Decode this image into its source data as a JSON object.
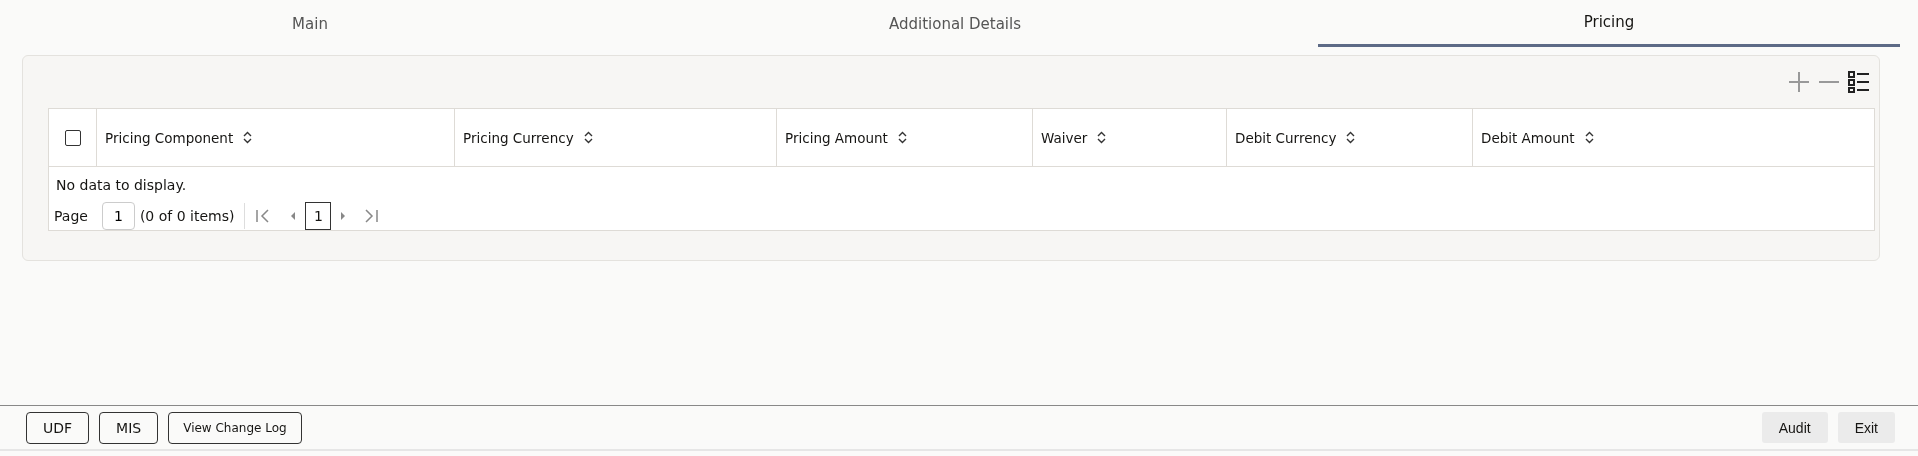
{
  "tabs": [
    {
      "label": "Main",
      "selected": false
    },
    {
      "label": "Additional Details",
      "selected": false
    },
    {
      "label": "Pricing",
      "selected": true
    }
  ],
  "table": {
    "select_all": {
      "checked": false
    },
    "columns": [
      "Pricing Component",
      "Pricing Currency",
      "Pricing Amount",
      "Waiver",
      "Debit Currency",
      "Debit Amount"
    ],
    "empty_message": "No data to display.",
    "pagination": {
      "page_label": "Page",
      "page_input": "1",
      "items": "(0 of 0 items)",
      "current_page": "1"
    }
  },
  "footer": {
    "left_buttons": [
      "UDF",
      "MIS",
      "View Change Log"
    ],
    "right_buttons": [
      "Audit",
      "Exit"
    ]
  }
}
